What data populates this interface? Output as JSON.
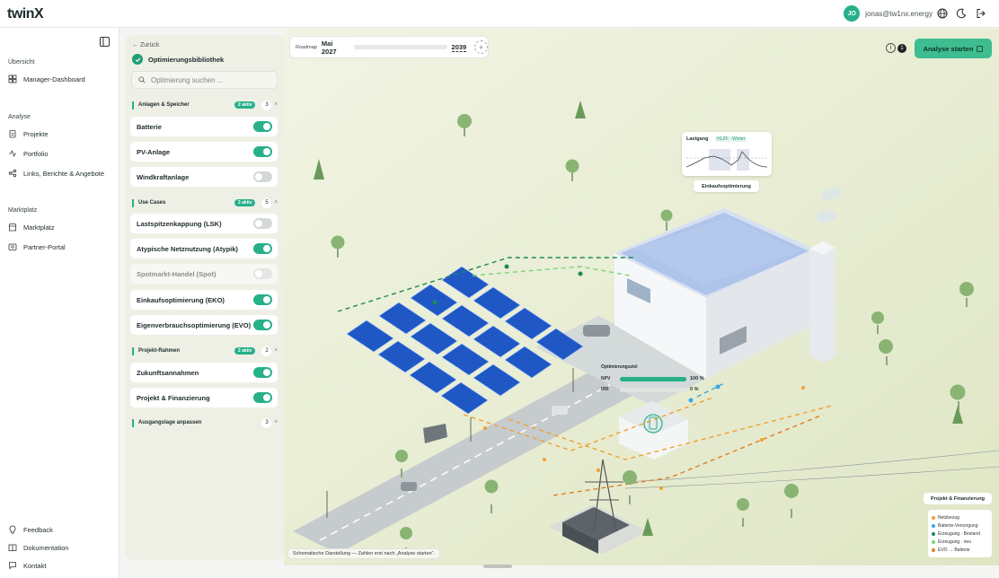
{
  "app": {
    "logo": "twinX"
  },
  "header": {
    "avatar_initials": "JO",
    "email": "jonas@tw1nx.energy"
  },
  "nav": {
    "overview_label": "Übersicht",
    "manager_dashboard": "Manager-Dashboard",
    "analyse_label": "Analyse",
    "projekte": "Projekte",
    "portfolio": "Portfolio",
    "links": "Links, Berichte & Angebote",
    "marketplace_label": "Marktplatz",
    "marktplatz": "Marktplatz",
    "partner": "Partner-Portal",
    "feedback": "Feedback",
    "docs": "Dokumentation",
    "contact": "Kontakt"
  },
  "library": {
    "back": "Zurück",
    "title": "Optimierungsbibliothek",
    "search_placeholder": "Optimierung suchen ...",
    "groups": [
      {
        "label": "Anlagen & Speicher",
        "badge": "2 aktiv",
        "count": "3",
        "items": [
          {
            "label": "Batterie",
            "on": true
          },
          {
            "label": "PV-Anlage",
            "on": true
          },
          {
            "label": "Windkraftanlage",
            "on": false
          }
        ]
      },
      {
        "label": "Use Cases",
        "badge": "3 aktiv",
        "count": "5",
        "items": [
          {
            "label": "Lastspitzenkappung (LSK)",
            "on": false
          },
          {
            "label": "Atypische Netznutzung (Atypik)",
            "on": true
          },
          {
            "label": "Spotmarkt-Handel (Spot)",
            "on": false
          },
          {
            "label": "Einkaufsoptimierung (EKO)",
            "on": true
          },
          {
            "label": "Eigenverbrauchsoptimierung (EVO)",
            "on": true
          }
        ]
      },
      {
        "label": "Projekt-Rahmen",
        "badge": "2 aktiv",
        "count": "2",
        "items": [
          {
            "label": "Zukunftsannahmen",
            "on": true
          },
          {
            "label": "Projekt & Finanzierung",
            "on": true
          }
        ]
      },
      {
        "label": "Ausgangslage anpassen",
        "badge": "",
        "count": "3",
        "items": []
      }
    ]
  },
  "roadmap": {
    "label": "Roadmap",
    "start": "Mai 2027",
    "end": "2039"
  },
  "actions": {
    "analyse": "Analyse starten",
    "info_count": "1"
  },
  "scene": {
    "lastgang_title": "Lastgang",
    "lastgang_badge": "HLZF · Winter",
    "eko_label": "Einkaufsoptimierung",
    "opt_title": "Optimierungsziel",
    "npv_label": "NPV",
    "npv_value": "100 %",
    "npv_fraction": 1.0,
    "irr_label": "IRR",
    "irr_value": "0 %",
    "irr_fraction": 0.0,
    "project_label": "Projekt & Finanzierung",
    "caption": "Schematische Darstellung — Zahlen erst nach „Analyse starten“."
  },
  "legend": [
    {
      "label": "Netzbezug",
      "color": "#f0a030"
    },
    {
      "label": "Batterie-Versorgung",
      "color": "#3aa8e0"
    },
    {
      "label": "Erzeugung · Bestand",
      "color": "#1f8a52"
    },
    {
      "label": "Erzeugung · neu",
      "color": "#7ad47a"
    },
    {
      "label": "EVO → Batterie",
      "color": "#e07d2a"
    }
  ]
}
